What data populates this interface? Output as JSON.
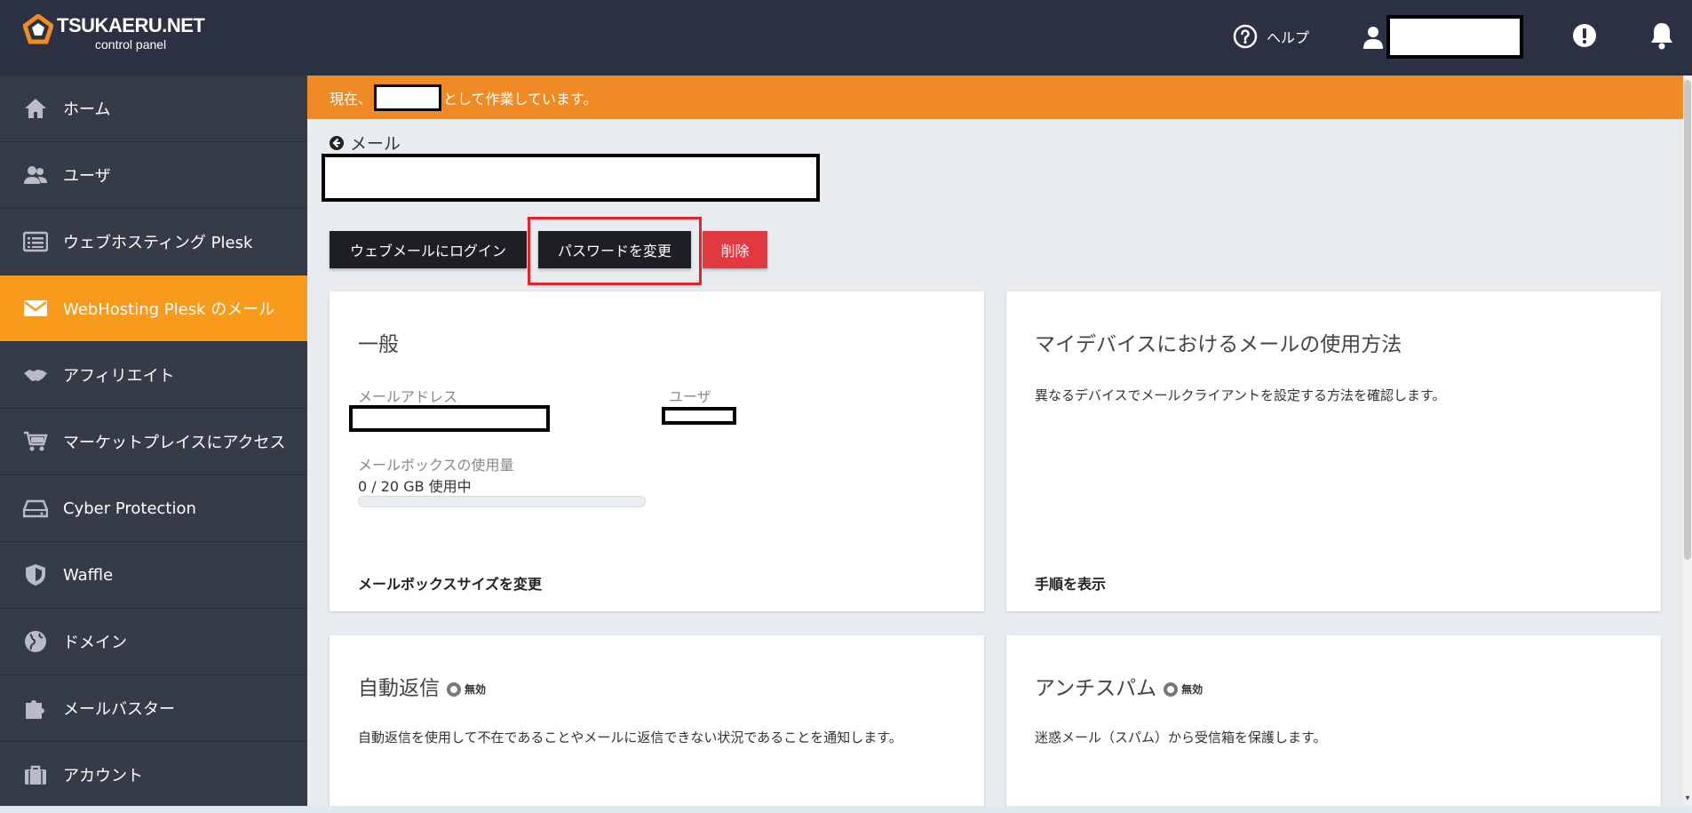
{
  "header": {
    "logo_title": "TSUKAERU.NET",
    "logo_subtitle": "control panel",
    "help_label": "ヘルプ",
    "icons": [
      "help-circle-icon",
      "user-icon",
      "alert-icon",
      "bell-icon"
    ]
  },
  "sidebar": {
    "items": [
      {
        "label": "ホーム",
        "icon": "home-icon"
      },
      {
        "label": "ユーザ",
        "icon": "users-icon"
      },
      {
        "label": "ウェブホスティング Plesk",
        "icon": "server-list-icon"
      },
      {
        "label": "WebHosting Plesk のメール",
        "icon": "envelope-icon"
      },
      {
        "label": "アフィリエイト",
        "icon": "handshake-icon"
      },
      {
        "label": "マーケットプレイスにアクセス",
        "icon": "cart-icon"
      },
      {
        "label": "Cyber Protection",
        "icon": "drive-icon"
      },
      {
        "label": "Waffle",
        "icon": "shield-icon"
      },
      {
        "label": "ドメイン",
        "icon": "globe-icon"
      },
      {
        "label": "メールバスター",
        "icon": "puzzle-icon"
      },
      {
        "label": "アカウント",
        "icon": "briefcase-icon"
      }
    ],
    "active_index": 3
  },
  "banner": {
    "prefix": "現在、",
    "suffix": "として作業しています。"
  },
  "breadcrumb": {
    "back_label": "メール"
  },
  "actions": {
    "webmail_label": "ウェブメールにログイン",
    "change_password_label": "パスワードを変更",
    "delete_label": "削除"
  },
  "general_card": {
    "title": "一般",
    "email_label": "メールアドレス",
    "user_label": "ユーザ",
    "usage_label": "メールボックスの使用量",
    "usage_text": "0 / 20 GB 使用中",
    "usage_fraction": 0,
    "link": "メールボックスサイズを変更"
  },
  "device_card": {
    "title": "マイデバイスにおけるメールの使用方法",
    "description": "異なるデバイスでメールクライアントを設定する方法を確認します。",
    "link": "手順を表示"
  },
  "autoreply_card": {
    "title": "自動返信",
    "status": "無効",
    "description": "自動返信を使用して不在であることやメールに返信できない状況であることを通知します。"
  },
  "antispam_card": {
    "title": "アンチスパム",
    "status": "無効",
    "description": "迷惑メール（スパム）から受信箱を保護します。"
  },
  "colors": {
    "topbar": "#2b3142",
    "sidebar": "#363b48",
    "accent": "#f89a1c",
    "banner": "#f08a24",
    "danger": "#e2383f"
  }
}
